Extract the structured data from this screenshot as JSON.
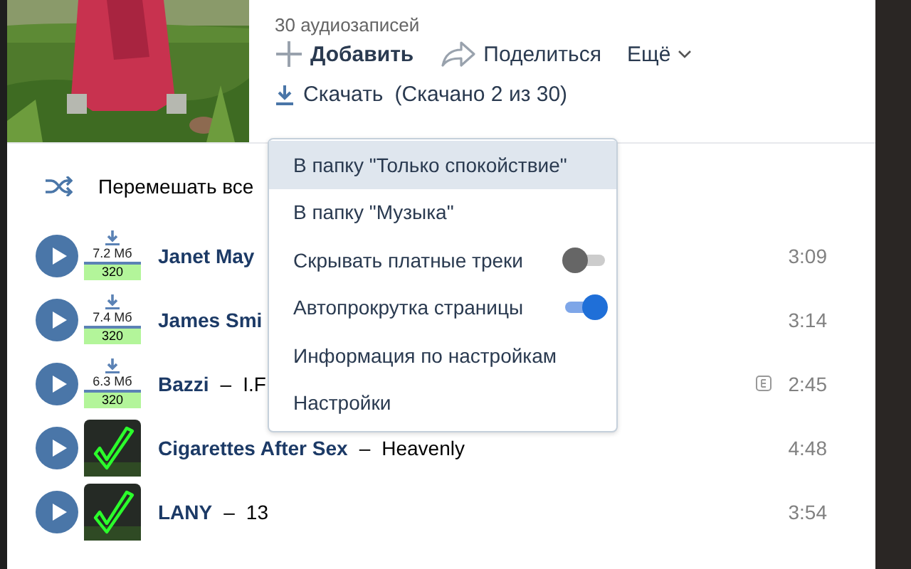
{
  "playlist": {
    "count": "30 аудиозаписей",
    "actions": [
      {
        "kind": "add",
        "label": "Добавить"
      },
      {
        "kind": "share",
        "label": "Поделиться"
      },
      {
        "kind": "more",
        "label": "Ещё"
      }
    ],
    "download": {
      "label": "Скачать",
      "status": "(Скачано 2 из 30)"
    }
  },
  "shuffle": {
    "label": "Перемешать все"
  },
  "tracks": [
    {
      "artist": "Janet May",
      "badge": {
        "kind": "size",
        "size": "7.2 Мб",
        "bitrate": "320"
      },
      "explicit": false,
      "duration": "3:09"
    },
    {
      "artist": "James Smi",
      "badge": {
        "kind": "size",
        "size": "7.4 Мб",
        "bitrate": "320"
      },
      "explicit": false,
      "duration": "3:14"
    },
    {
      "artist": "Bazzi",
      "separator": "–",
      "title": "I.F",
      "badge": {
        "kind": "size",
        "size": "6.3 Мб",
        "bitrate": "320"
      },
      "explicit": true,
      "duration": "2:45"
    },
    {
      "artist": "Cigarettes After Sex",
      "separator": "–",
      "title": "Heavenly",
      "badge": {
        "kind": "done"
      },
      "explicit": false,
      "duration": "4:48"
    },
    {
      "artist": "LANY",
      "separator": "–",
      "title": "13",
      "badge": {
        "kind": "done"
      },
      "explicit": false,
      "duration": "3:54"
    }
  ],
  "menu": {
    "items": [
      {
        "kind": "item",
        "label": "В папку \"Только спокойствие\"",
        "selected": true
      },
      {
        "kind": "item",
        "label": "В папку \"Музыка\"",
        "selected": false
      },
      {
        "kind": "toggle",
        "label": "Скрывать платные треки",
        "on": false,
        "selected": false
      },
      {
        "kind": "toggle",
        "label": "Автопрокрутка страницы",
        "on": true,
        "selected": false
      },
      {
        "kind": "item",
        "label": "Информация по настройкам",
        "selected": false
      },
      {
        "kind": "item",
        "label": "Настройки",
        "selected": false
      }
    ]
  }
}
